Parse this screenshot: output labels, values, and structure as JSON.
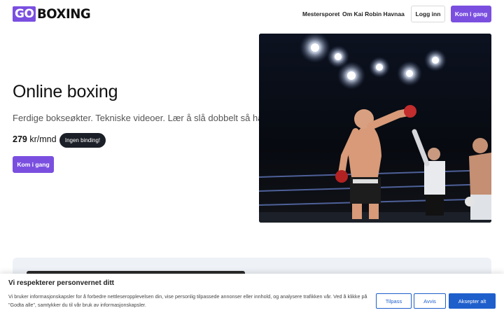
{
  "header": {
    "logo_mark": "GO",
    "logo_word": "BOXING",
    "nav": [
      {
        "label": "Mestersporet"
      },
      {
        "label": "Om Kai Robin Havnaa"
      }
    ],
    "login_label": "Logg inn",
    "cta_label": "Kom i gang"
  },
  "hero": {
    "title": "Online boxing",
    "subtitle": "Ferdige bokseøkter. Tekniske videoer. Lær å slå dobbelt så hardt.",
    "price_value": "279",
    "price_unit": "kr/mnd",
    "badge": "Ingen binding!",
    "cta_label": "Kom i gang"
  },
  "cookie": {
    "title": "Vi respekterer personvernet ditt",
    "text": "Vi bruker informasjonskapsler for å forbedre nettleseropplevelsen din, vise personlig tilpassede annonser eller innhold, og analysere trafikken vår. Ved å klikke på \"Godta alle\", samtykker du til vår bruk av informasjonskapsler.",
    "customize_label": "Tilpass",
    "reject_label": "Avvis",
    "accept_label": "Aksepter alt"
  },
  "colors": {
    "brand": "#7a4fe0",
    "badge_bg": "#1b1f27",
    "cookie_accent": "#1f5fcc"
  }
}
